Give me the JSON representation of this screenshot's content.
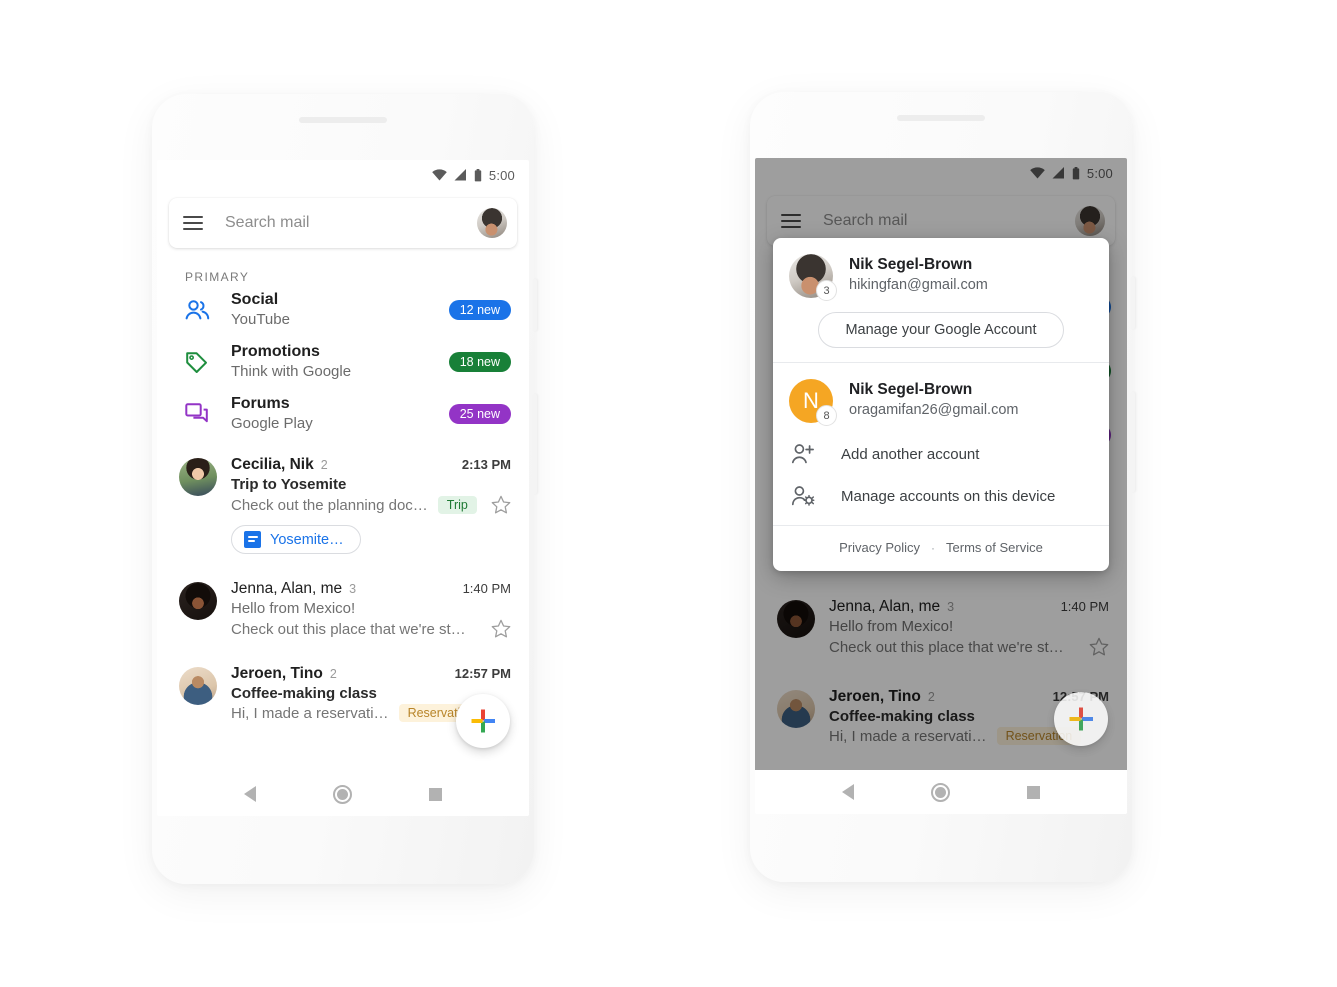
{
  "status_bar": {
    "time": "5:00",
    "icons": [
      "wifi-icon",
      "signal-icon",
      "battery-icon"
    ]
  },
  "search": {
    "placeholder": "Search mail",
    "menu_icon": "hamburger-menu-icon",
    "avatar_icon": "account-avatar"
  },
  "left_phone": {
    "section_label": "PRIMARY",
    "categories": [
      {
        "icon": "social-people-icon",
        "title": "Social",
        "subtitle": "YouTube",
        "badge": "12 new",
        "badge_color": "#1a73e8",
        "icon_color": "#1a73e8"
      },
      {
        "icon": "promotions-tag-icon",
        "title": "Promotions",
        "subtitle": "Think with Google",
        "badge": "18 new",
        "badge_color": "#188038",
        "icon_color": "#1e8e3e"
      },
      {
        "icon": "forums-chat-icon",
        "title": "Forums",
        "subtitle": "Google Play",
        "badge": "25 new",
        "badge_color": "#9334c6",
        "icon_color": "#9334c6"
      }
    ],
    "mails": [
      {
        "avatar": "cecilia-avatar",
        "sender": "Cecilia, Nik",
        "count": "2",
        "time": "2:13 PM",
        "subject": "Trip to Yosemite",
        "snippet": "Check out the planning doc…",
        "tag": "Trip",
        "tag_bg": "#e2f3e6",
        "tag_color": "#1e7a34",
        "unread": true,
        "attachment": "Yosemite…",
        "attachment_icon": "google-docs-icon",
        "star_icon": "star-outline-icon"
      },
      {
        "avatar": "jenna-avatar",
        "sender": "Jenna, Alan, me",
        "count": "3",
        "time": "1:40 PM",
        "subject": "Hello from Mexico!",
        "snippet": "Check out this place that we're st…",
        "tag": "",
        "unread": false,
        "star_icon": "star-outline-icon"
      },
      {
        "avatar": "jeroen-avatar",
        "sender": "Jeroen, Tino",
        "count": "2",
        "time": "12:57 PM",
        "subject": "Coffee-making class",
        "snippet": "Hi, I made a reservati…",
        "tag": "Reservation",
        "tag_bg": "#fdf2db",
        "tag_color": "#b8852a",
        "unread": true
      }
    ],
    "fab": {
      "icon": "compose-plus-icon",
      "label": ""
    },
    "nav": {
      "back": "back-nav-icon",
      "home": "home-nav-icon",
      "recents": "recents-nav-icon"
    }
  },
  "right_phone": {
    "account_panel": {
      "primary_account": {
        "avatar": "nik-photo-avatar",
        "unread_badge": "3",
        "name": "Nik Segel-Brown",
        "email": "hikingfan@gmail.com",
        "manage_button": "Manage your Google Account"
      },
      "secondary_account": {
        "avatar_letter": "N",
        "avatar_color": "#f5a623",
        "unread_badge": "8",
        "name": "Nik Segel-Brown",
        "email": "oragamifan26@gmail.com"
      },
      "menu_items": [
        {
          "icon": "add-person-icon",
          "label": "Add another account"
        },
        {
          "icon": "manage-accounts-icon",
          "label": "Manage accounts on this device"
        }
      ],
      "footer": {
        "privacy": "Privacy Policy",
        "separator": "·",
        "terms": "Terms of Service"
      }
    },
    "mails": [
      {
        "avatar": "jenna-avatar",
        "sender": "Jenna, Alan, me",
        "count": "3",
        "time": "1:40 PM",
        "subject": "Hello from Mexico!",
        "snippet": "Check out this place that we're st…",
        "unread": false,
        "star_icon": "star-outline-icon"
      },
      {
        "avatar": "jeroen-avatar",
        "sender": "Jeroen, Tino",
        "count": "2",
        "time": "12:57 PM",
        "subject": "Coffee-making class",
        "snippet": "Hi, I made a reservati…",
        "tag": "Reservation",
        "tag_bg": "#fdf2db",
        "tag_color": "#b8852a",
        "unread": true
      }
    ],
    "fab": {
      "icon": "compose-plus-icon"
    },
    "nav": {
      "back": "back-nav-icon",
      "home": "home-nav-icon",
      "recents": "recents-nav-icon"
    }
  },
  "theme": {
    "google_blue": "#4285f4",
    "google_red": "#ea4335",
    "google_yellow": "#fbbc05",
    "google_green": "#34a853"
  }
}
